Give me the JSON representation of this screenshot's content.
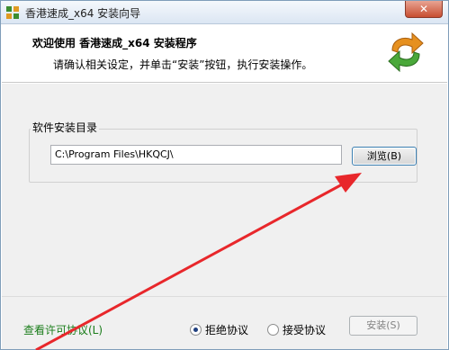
{
  "window": {
    "title": "香港速成_x64 安装向导",
    "close_glyph": "✕"
  },
  "header": {
    "title": "欢迎使用 香港速成_x64 安装程序",
    "subtitle": "请确认相关设定，并单击“安装”按钮，执行安装操作。"
  },
  "install_dir": {
    "group_label": "软件安装目录",
    "path_value": "C:\\Program Files\\HKQCJ\\",
    "browse_label": "浏览(B)"
  },
  "footer": {
    "license_link": "查看许可协议(L)",
    "radio_reject": "拒绝协议",
    "radio_accept": "接受协议",
    "selected": "拒绝协议",
    "install_label": "安装(S)"
  },
  "colors": {
    "link_green": "#1a7d1a",
    "annotation_red": "#e8272b"
  }
}
